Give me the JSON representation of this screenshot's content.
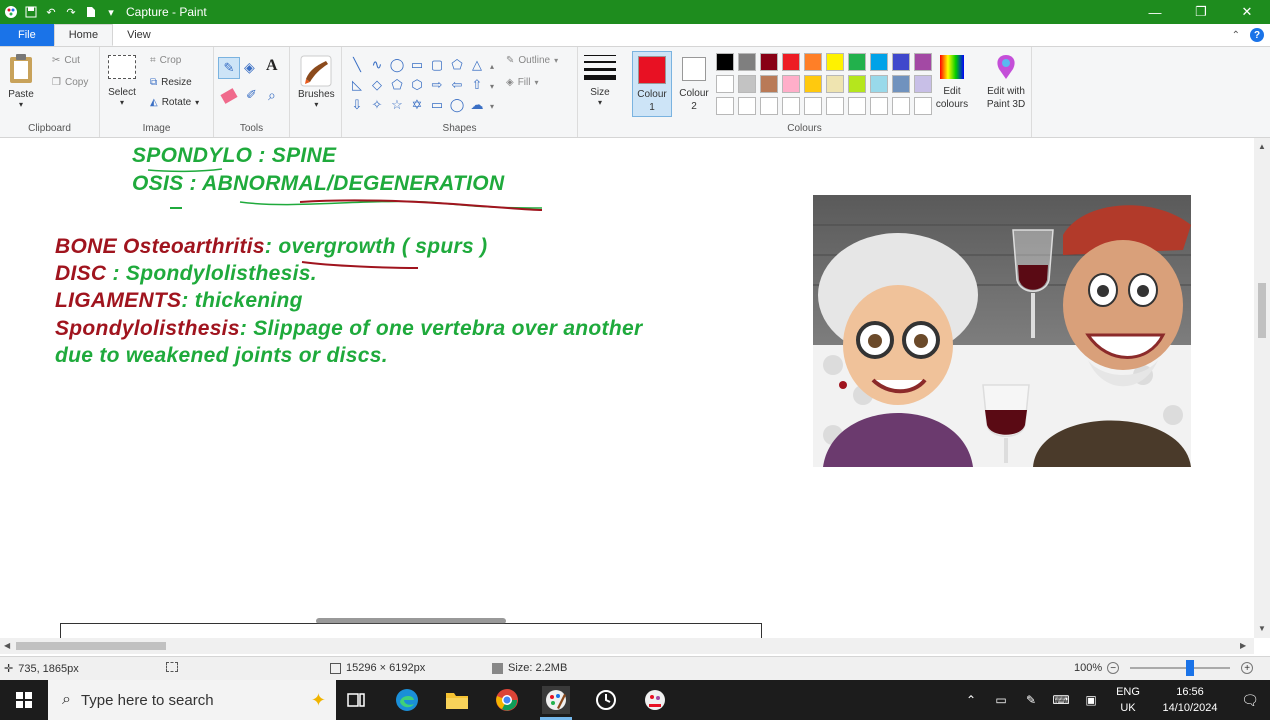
{
  "window": {
    "title": "Capture - Paint",
    "minimize": "—",
    "maximize": "❐",
    "close": "✕"
  },
  "tabs": {
    "file": "File",
    "home": "Home",
    "view": "View"
  },
  "ribbon": {
    "clipboard": {
      "label": "Clipboard",
      "paste": "Paste",
      "cut": "Cut",
      "copy": "Copy"
    },
    "image": {
      "label": "Image",
      "select": "Select",
      "crop": "Crop",
      "resize": "Resize",
      "rotate": "Rotate"
    },
    "tools": {
      "label": "Tools"
    },
    "brushes": "Brushes",
    "shapes": {
      "label": "Shapes",
      "outline": "Outline",
      "fill": "Fill"
    },
    "size": "Size",
    "colour1": "Colour 1",
    "colour2": "Colour 2",
    "colours_label": "Colours",
    "edit_colours": "Edit colours",
    "edit_paint3d": "Edit with Paint 3D",
    "colour1_value": "#e81123",
    "colour2_value": "#ffffff",
    "palette_row1": [
      "#000000",
      "#7f7f7f",
      "#880015",
      "#ed1c24",
      "#ff7f27",
      "#fff200",
      "#22b14c",
      "#00a2e8",
      "#3f48cc",
      "#a349a4"
    ],
    "palette_row2": [
      "#ffffff",
      "#c3c3c3",
      "#b97a57",
      "#ffaec9",
      "#ffc90e",
      "#efe4b0",
      "#b5e61d",
      "#99d9ea",
      "#7092be",
      "#c8bfe7"
    ],
    "palette_row3": [
      "#ffffff",
      "#ffffff",
      "#ffffff",
      "#ffffff",
      "#ffffff",
      "#ffffff",
      "#ffffff",
      "#ffffff",
      "#ffffff",
      "#ffffff"
    ]
  },
  "canvas": {
    "line1": "SPONDYLO : SPINE",
    "line2": "OSIS : ABNORMAL/DEGENERATION",
    "bone_label": "BONE Osteoarthritis",
    "bone_text": ": overgrowth ( spurs )",
    "disc_label": "DISC",
    "disc_text": " : Spondylolisthesis.",
    "lig_label": "LIGAMENTS",
    "lig_text": ": thickening",
    "spondy_label": "Spondylolisthesis",
    "spondy_text": ": Slippage of one vertebra over another",
    "spondy_text2": "due to weakened joints or discs."
  },
  "status": {
    "cursor": "735, 1865px",
    "dimensions": "15296 × 6192px",
    "size": "Size: 2.2MB",
    "zoom": "100%"
  },
  "taskbar": {
    "search_placeholder": "Type here to search",
    "lang1": "ENG",
    "lang2": "UK",
    "time": "16:56",
    "date": "14/10/2024"
  }
}
